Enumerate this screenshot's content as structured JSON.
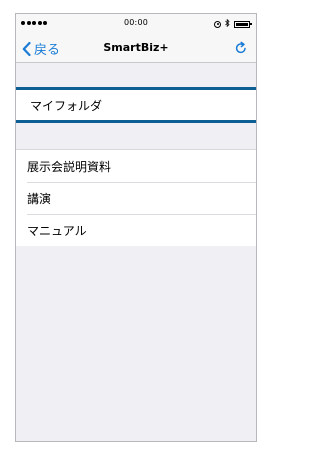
{
  "status_bar": {
    "time": "00:00"
  },
  "nav": {
    "back_label": "戻る",
    "title": "SmartBiz+"
  },
  "sections": {
    "my_folder": "マイフォルダ",
    "items": [
      "展示会説明資料",
      "講演",
      "マニュアル"
    ]
  },
  "colors": {
    "accent": "#1a7cd6",
    "selection_border": "#0d5f93",
    "background": "#efeff4"
  },
  "icons": {
    "back": "chevron-left-icon",
    "refresh": "refresh-icon",
    "signal": "signal-dots-icon",
    "orientation_lock": "orientation-lock-icon",
    "bluetooth": "bluetooth-icon",
    "battery": "battery-icon"
  }
}
